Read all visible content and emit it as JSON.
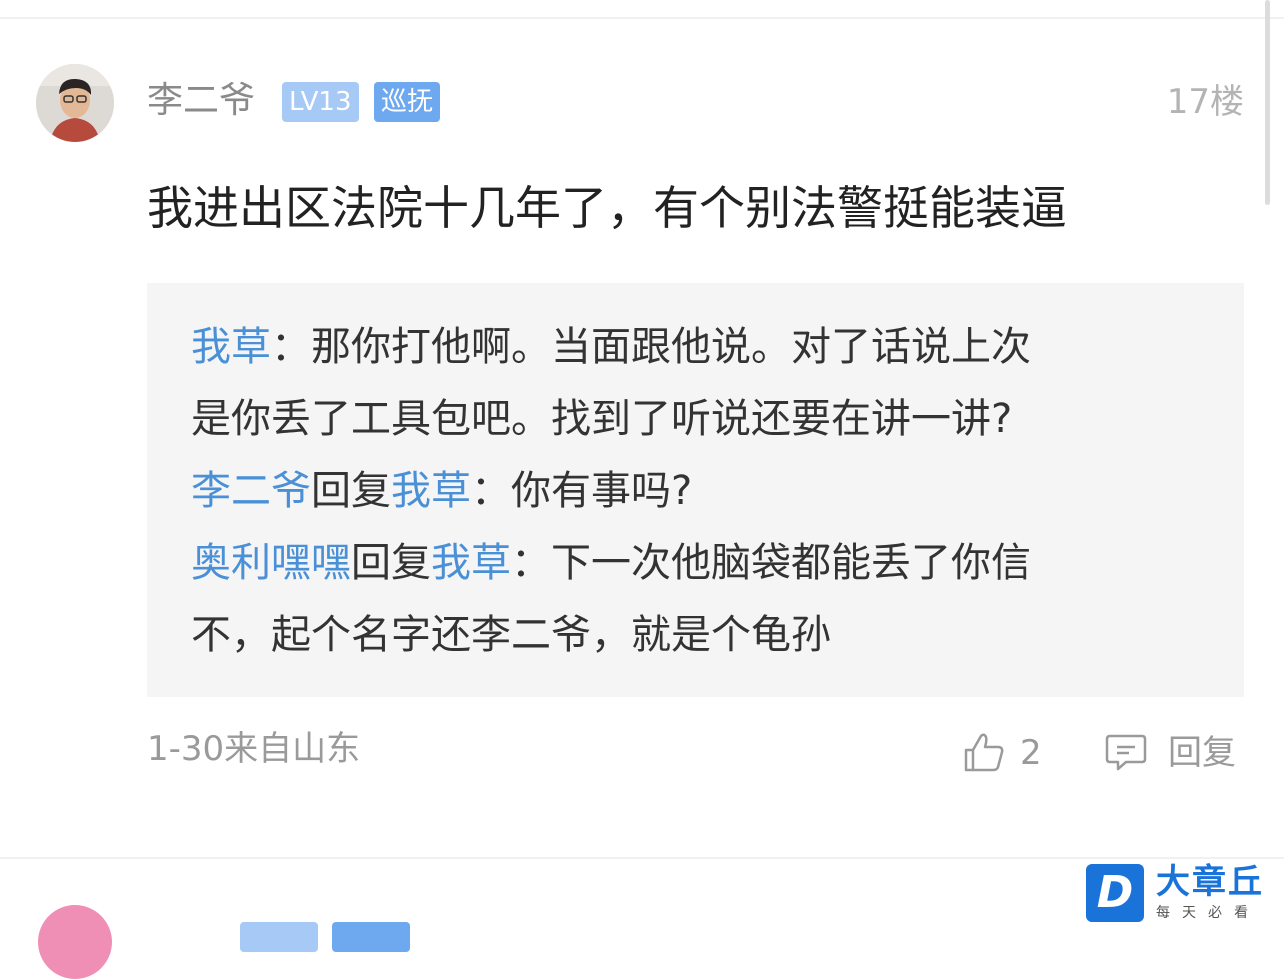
{
  "comment": {
    "username": "李二爷",
    "level_badge": "LV13",
    "role_badge": "巡抚",
    "floor": "17楼",
    "content": "我进出区法院十几年了，有个别法警挺能装逼",
    "replies": [
      {
        "lines": [
          [
            {
              "text": "我草",
              "blue": true
            },
            {
              "text": "：那你打他啊。当面跟他说。对了话说上次",
              "blue": false
            }
          ],
          [
            {
              "text": "是你丢了工具包吧。找到了听说还要在讲一讲?",
              "blue": false
            }
          ]
        ]
      },
      {
        "lines": [
          [
            {
              "text": "李二爷",
              "blue": true
            },
            {
              "text": "回复",
              "blue": false
            },
            {
              "text": "我草",
              "blue": true
            },
            {
              "text": "：你有事吗?",
              "blue": false
            }
          ]
        ]
      },
      {
        "lines": [
          [
            {
              "text": "奥利嘿嘿",
              "blue": true
            },
            {
              "text": "回复",
              "blue": false
            },
            {
              "text": "我草",
              "blue": true
            },
            {
              "text": "：下一次他脑袋都能丢了你信",
              "blue": false
            }
          ],
          [
            {
              "text": "不，起个名字还李二爷，就是个龟孙",
              "blue": false
            }
          ]
        ]
      }
    ],
    "meta": "1-30来自山东",
    "like_count": "2",
    "reply_label": "回复"
  },
  "next_comment": {
    "username": "",
    "level_badge": "",
    "role_badge": ""
  },
  "watermark": {
    "logo_letter": "D",
    "title": "大章丘",
    "subtitle": "每天必看"
  },
  "colors": {
    "blue_link": "#4a90d6",
    "badge_light": "#a7c9f5",
    "badge_dark": "#6ea8ef",
    "reply_bg": "#f5f5f5",
    "watermark_blue": "#1a73d9"
  },
  "icons": {
    "like": "thumbs-up-icon",
    "reply": "comment-icon"
  }
}
